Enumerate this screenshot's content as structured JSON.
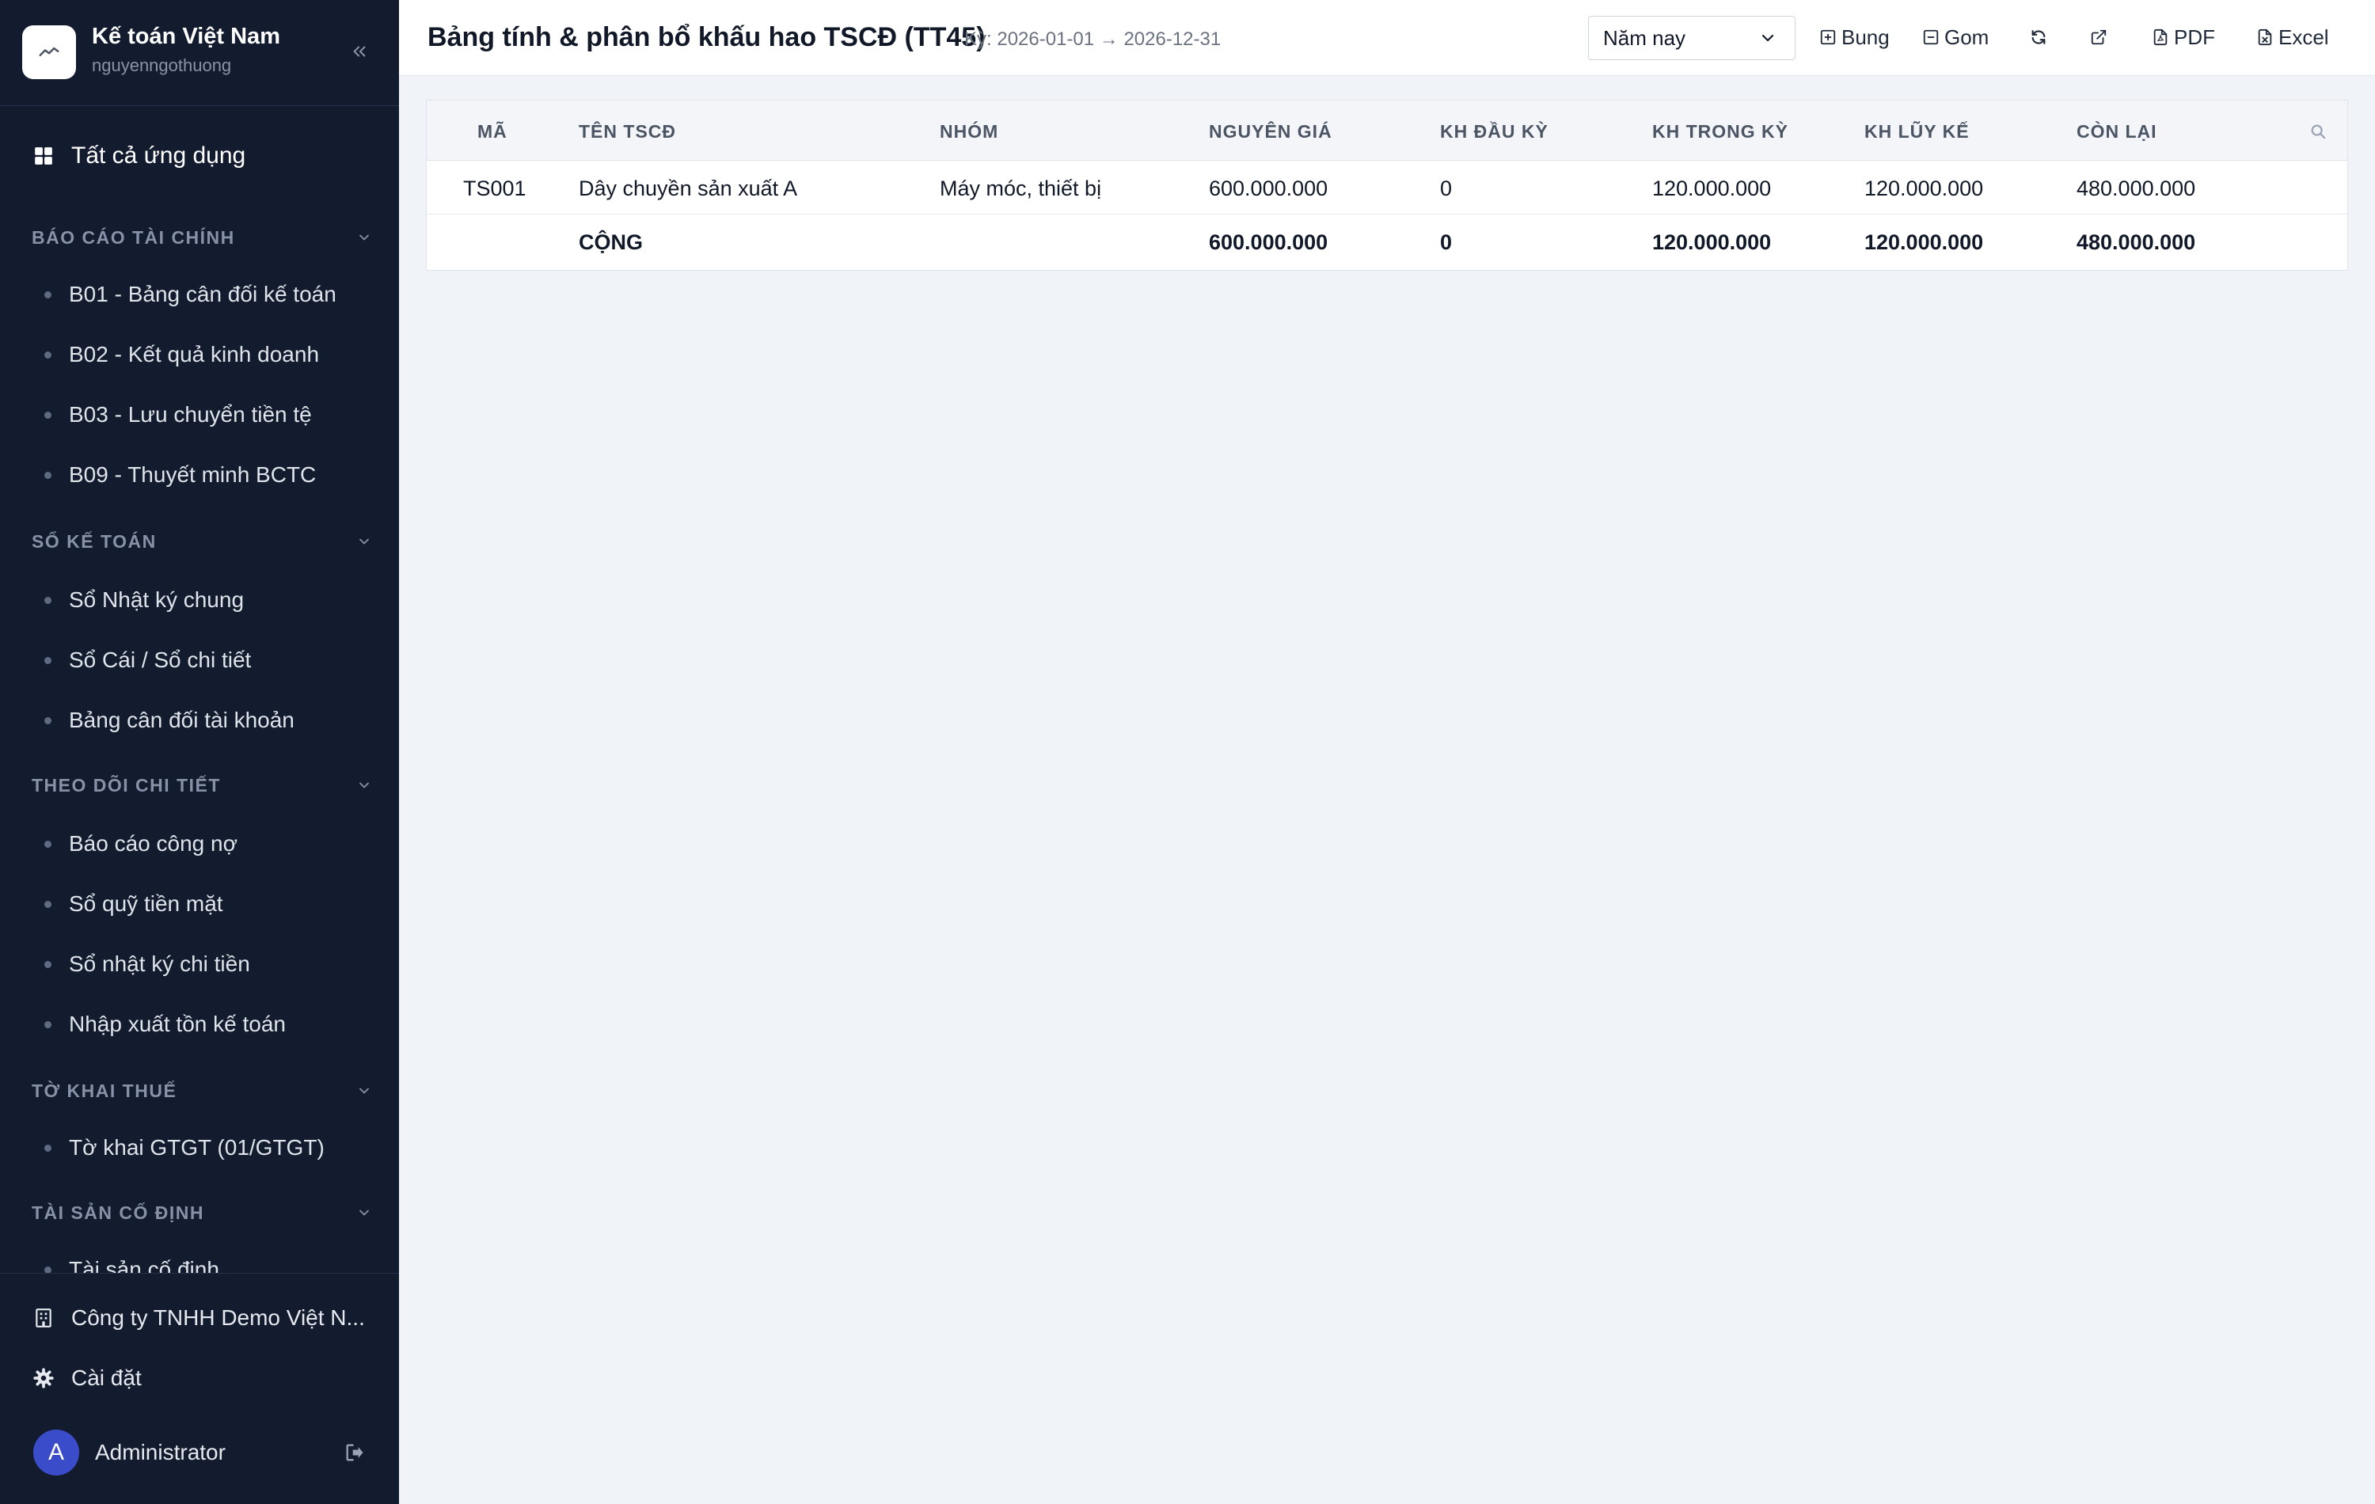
{
  "app": {
    "name": "Kế toán Việt Nam",
    "username": "nguyenngothuong"
  },
  "sidebar": {
    "all_apps": "Tất cả ứng dụng",
    "sections": [
      {
        "title": "BÁO CÁO TÀI CHÍNH",
        "items": [
          "B01 - Bảng cân đối kế toán",
          "B02 - Kết quả kinh doanh",
          "B03 - Lưu chuyển tiền tệ",
          "B09 - Thuyết minh BCTC"
        ]
      },
      {
        "title": "SỔ KẾ TOÁN",
        "items": [
          "Sổ Nhật ký chung",
          "Sổ Cái / Sổ chi tiết",
          "Bảng cân đối tài khoản"
        ]
      },
      {
        "title": "THEO DÕI CHI TIẾT",
        "items": [
          "Báo cáo công nợ",
          "Sổ quỹ tiền mặt",
          "Sổ nhật ký chi tiền",
          "Nhập xuất tồn kế toán"
        ]
      },
      {
        "title": "TỜ KHAI THUẾ",
        "items": [
          "Tờ khai GTGT (01/GTGT)"
        ]
      },
      {
        "title": "TÀI SẢN CỐ ĐỊNH",
        "items": [
          "Tài sản cố định"
        ]
      }
    ],
    "company": "Công ty TNHH Demo Việt N...",
    "settings": "Cài đặt",
    "user": {
      "initial": "A",
      "name": "Administrator"
    }
  },
  "header": {
    "title": "Bảng tính & phân bổ khấu hao TSCĐ (TT45)",
    "period": "Kỳ: 2026-01-01 → 2026-12-31",
    "period_select": "Năm nay",
    "expand_label": "Bung",
    "collapse_label": "Gom",
    "pdf_label": "PDF",
    "excel_label": "Excel"
  },
  "table": {
    "columns": [
      "MÃ",
      "TÊN TSCĐ",
      "NHÓM",
      "NGUYÊN GIÁ",
      "KH ĐẦU KỲ",
      "KH TRONG KỲ",
      "KH LŨY KẾ",
      "CÒN LẠI"
    ],
    "rows": [
      [
        "TS001",
        "Dây chuyền sản xuất A",
        "Máy móc, thiết bị",
        "600.000.000",
        "0",
        "120.000.000",
        "120.000.000",
        "480.000.000"
      ]
    ],
    "total": [
      "",
      "CỘNG",
      "",
      "600.000.000",
      "0",
      "120.000.000",
      "120.000.000",
      "480.000.000"
    ]
  },
  "colors": {
    "sidebar_bg": "#131c2e",
    "page_bg": "#f0f3f8",
    "avatar_bg": "#3b4cca"
  }
}
